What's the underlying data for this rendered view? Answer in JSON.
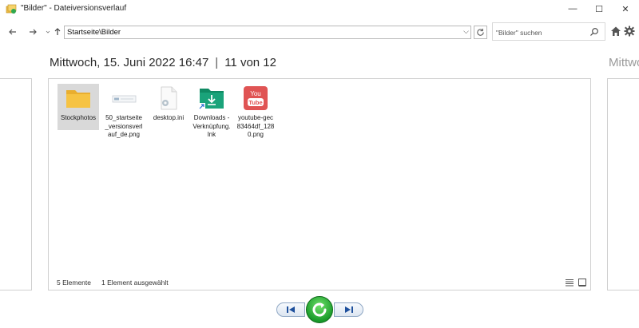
{
  "window": {
    "title": "\"Bilder\" - Dateiversionsverlauf",
    "controls": {
      "minimize": "—",
      "maximize": "☐",
      "close": "✕"
    }
  },
  "nav": {
    "address": "Startseite\\Bilder",
    "search_placeholder": "\"Bilder\" suchen"
  },
  "header": {
    "date": "Mittwoch, 15. Juni 2022 16:47",
    "separator": "|",
    "position": "11 von 12",
    "next_date": "Mittwoch"
  },
  "files": [
    {
      "label": "Stockphotos",
      "icon": "folder-icon",
      "selected": true
    },
    {
      "label": "50_startseite_versionsverlauf_de.png",
      "icon": "image-file-icon",
      "selected": false
    },
    {
      "label": "desktop.ini",
      "icon": "settings-file-icon",
      "selected": false
    },
    {
      "label": "Downloads - Verknüpfung.lnk",
      "icon": "download-shortcut-icon",
      "selected": false
    },
    {
      "label": "youtube-gec83464df_1280.png",
      "icon": "youtube-icon",
      "selected": false
    }
  ],
  "status": {
    "count": "5 Elemente",
    "selection": "1 Element ausgewählt"
  },
  "colors": {
    "folder": "#f6c343",
    "download_shortcut": "#1aa37a",
    "youtube": "#e05454",
    "restore": "#1fa33a"
  }
}
